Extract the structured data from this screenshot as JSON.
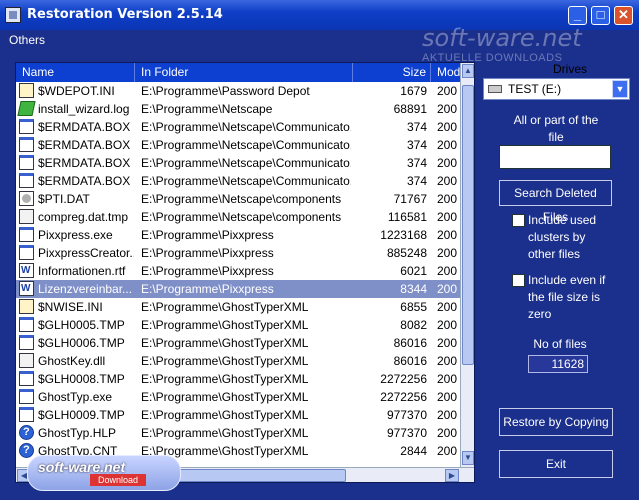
{
  "window": {
    "title": "Restoration Version 2.5.14",
    "min_label": "_",
    "max_label": "□",
    "close_label": "✕"
  },
  "menu": {
    "others": "Others"
  },
  "watermark": {
    "main": "soft-ware.net",
    "sub": "AKTUELLE DOWNLOADS"
  },
  "list": {
    "columns": {
      "name": "Name",
      "folder": "In Folder",
      "size": "Size",
      "mod": "Mod"
    },
    "rows": [
      {
        "icon": "cfg",
        "name": "$WDEPOT.INI",
        "folder": "E:\\Programme\\Password Depot",
        "size": "1679",
        "mod": "200"
      },
      {
        "icon": "wiz",
        "name": "install_wizard.log",
        "folder": "E:\\Programme\\Netscape",
        "size": "68891",
        "mod": "200"
      },
      {
        "icon": "exe",
        "name": "$ERMDATA.BOX",
        "folder": "E:\\Programme\\Netscape\\Communicato...",
        "size": "374",
        "mod": "200"
      },
      {
        "icon": "exe",
        "name": "$ERMDATA.BOX",
        "folder": "E:\\Programme\\Netscape\\Communicato...",
        "size": "374",
        "mod": "200"
      },
      {
        "icon": "exe",
        "name": "$ERMDATA.BOX",
        "folder": "E:\\Programme\\Netscape\\Communicato...",
        "size": "374",
        "mod": "200"
      },
      {
        "icon": "exe",
        "name": "$ERMDATA.BOX",
        "folder": "E:\\Programme\\Netscape\\Communicato...",
        "size": "374",
        "mod": "200"
      },
      {
        "icon": "sys",
        "name": "$PTI.DAT",
        "folder": "E:\\Programme\\Netscape\\components",
        "size": "71767",
        "mod": "200"
      },
      {
        "icon": "dll",
        "name": "compreg.dat.tmp",
        "folder": "E:\\Programme\\Netscape\\components",
        "size": "116581",
        "mod": "200"
      },
      {
        "icon": "exe",
        "name": "Pixxpress.exe",
        "folder": "E:\\Programme\\Pixxpress",
        "size": "1223168",
        "mod": "200"
      },
      {
        "icon": "exe",
        "name": "PixxpressCreator...",
        "folder": "E:\\Programme\\Pixxpress",
        "size": "885248",
        "mod": "200"
      },
      {
        "icon": "doc",
        "name": "Informationen.rtf",
        "folder": "E:\\Programme\\Pixxpress",
        "size": "6021",
        "mod": "200"
      },
      {
        "icon": "doc",
        "name": "Lizenzvereinbar...",
        "folder": "E:\\Programme\\Pixxpress",
        "size": "8344",
        "mod": "200",
        "selected": true
      },
      {
        "icon": "cfg",
        "name": "$NWISE.INI",
        "folder": "E:\\Programme\\GhostTyperXML",
        "size": "6855",
        "mod": "200"
      },
      {
        "icon": "exe",
        "name": "$GLH0005.TMP",
        "folder": "E:\\Programme\\GhostTyperXML",
        "size": "8082",
        "mod": "200"
      },
      {
        "icon": "exe",
        "name": "$GLH0006.TMP",
        "folder": "E:\\Programme\\GhostTyperXML",
        "size": "86016",
        "mod": "200"
      },
      {
        "icon": "dll",
        "name": "GhostKey.dll",
        "folder": "E:\\Programme\\GhostTyperXML",
        "size": "86016",
        "mod": "200"
      },
      {
        "icon": "exe",
        "name": "$GLH0008.TMP",
        "folder": "E:\\Programme\\GhostTyperXML",
        "size": "2272256",
        "mod": "200"
      },
      {
        "icon": "exe",
        "name": "GhostTyp.exe",
        "folder": "E:\\Programme\\GhostTyperXML",
        "size": "2272256",
        "mod": "200"
      },
      {
        "icon": "exe",
        "name": "$GLH0009.TMP",
        "folder": "E:\\Programme\\GhostTyperXML",
        "size": "977370",
        "mod": "200"
      },
      {
        "icon": "help",
        "name": "GhostTyp.HLP",
        "folder": "E:\\Programme\\GhostTyperXML",
        "size": "977370",
        "mod": "200"
      },
      {
        "icon": "help",
        "name": "GhostTyp.CNT",
        "folder": "E:\\Programme\\GhostTyperXML",
        "size": "2844",
        "mod": "200"
      }
    ]
  },
  "panel": {
    "drives_label": "Drives",
    "drive_value": "TEST (E:)",
    "search_label": "All or part of the file",
    "search_value": "",
    "search_button": "Search Deleted Files",
    "option1": "Include used clusters by other files",
    "option2": "Include even if the file size is zero",
    "nofiles_label": "No of files",
    "nofiles_value": "11628",
    "restore_button": "Restore by Copying",
    "exit_button": "Exit"
  },
  "badge": {
    "main": "soft-ware.net",
    "sub": "Download"
  }
}
